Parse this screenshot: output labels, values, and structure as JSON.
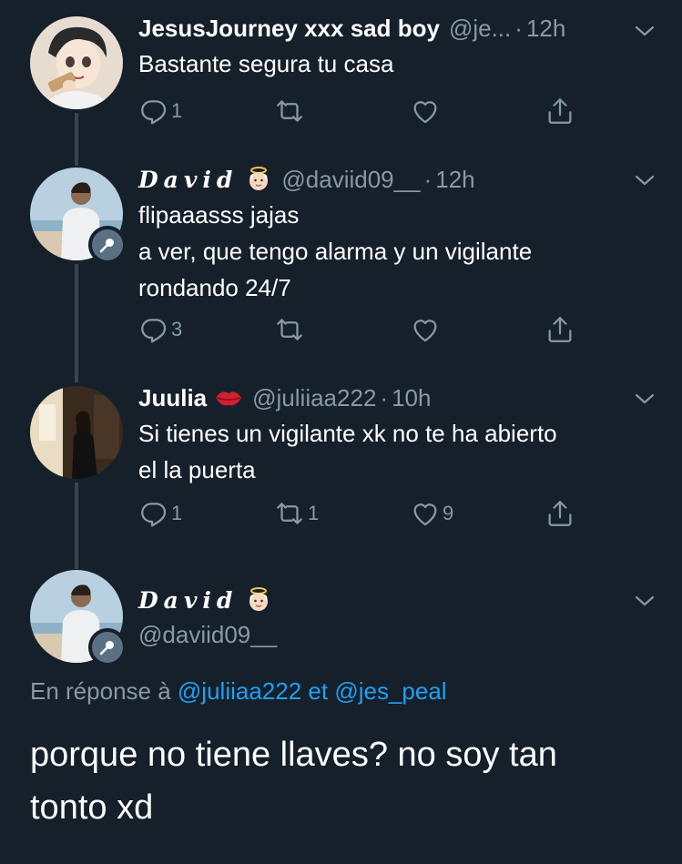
{
  "colors": {
    "background": "#15202b",
    "text": "#ffffff",
    "secondary": "#8899a6",
    "link": "#1da1f2",
    "thread_line": "#38444d"
  },
  "tweets": [
    {
      "name": "JesusJourney xxx sad boy",
      "handle": "@je...",
      "dot": "·",
      "time": "12h",
      "text": "Bastante segura tu casa",
      "reply_count": "1",
      "retweet_count": "",
      "like_count": ""
    },
    {
      "name": "David",
      "name_emoji": "angel-baby-emoji",
      "handle": "@daviid09__",
      "dot": "·",
      "time": "12h",
      "text_lines": [
        "flipaaasss jajas",
        "a ver, que tengo alarma y un vigilante",
        "rondando 24/7"
      ],
      "reply_count": "3",
      "retweet_count": "",
      "like_count": ""
    },
    {
      "name": "Juulia",
      "name_emoji": "kiss-lips-emoji",
      "handle": "@juliiaa222",
      "dot": "·",
      "time": "10h",
      "text_lines": [
        "Si tienes un vigilante xk no te ha abierto",
        "el la puerta"
      ],
      "reply_count": "1",
      "retweet_count": "1",
      "like_count": "9"
    }
  ],
  "main_tweet": {
    "name": "David",
    "name_emoji": "angel-baby-emoji",
    "handle": "@daviid09__",
    "reply_prefix": "En réponse à",
    "reply_mention_1": "@juliiaa222",
    "reply_connector": "et",
    "reply_mention_2": "@jes_peal",
    "text_line_1": "porque no tiene llaves? no soy tan",
    "text_line_2": "tonto xd"
  }
}
